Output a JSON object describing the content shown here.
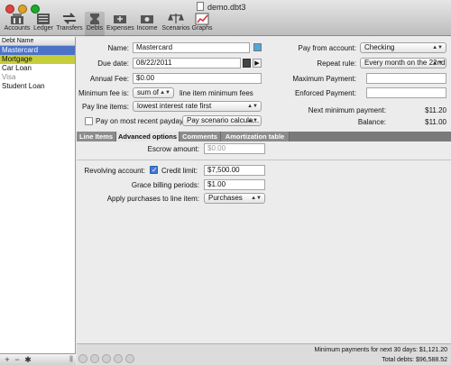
{
  "window": {
    "title": "demo.dbt3"
  },
  "toolbar": {
    "items": [
      {
        "label": "Accounts",
        "icon": "accounts-icon"
      },
      {
        "label": "Ledger",
        "icon": "ledger-icon"
      },
      {
        "label": "Transfers",
        "icon": "transfers-icon"
      },
      {
        "label": "Debts",
        "icon": "debts-icon"
      },
      {
        "label": "Expenses",
        "icon": "expenses-icon"
      },
      {
        "label": "Income",
        "icon": "income-icon"
      },
      {
        "label": "Scenarios",
        "icon": "scenarios-icon"
      },
      {
        "label": "Graphs",
        "icon": "graphs-icon"
      }
    ],
    "selected": "Debts"
  },
  "sidebar": {
    "header": "Debt Name",
    "items": [
      {
        "label": "Mastercard",
        "state": "selected"
      },
      {
        "label": "Mortgage",
        "state": "highlight"
      },
      {
        "label": "Car Loan",
        "state": "normal"
      },
      {
        "label": "Visa",
        "state": "muted"
      },
      {
        "label": "Student Loan",
        "state": "normal"
      }
    ],
    "add_label": "+",
    "remove_label": "−",
    "settings_label": "✱"
  },
  "form": {
    "name_label": "Name:",
    "name_value": "Mastercard",
    "due_date_label": "Due date:",
    "due_date_value": "08/22/2011",
    "annual_fee_label": "Annual Fee:",
    "annual_fee_value": "$0.00",
    "min_fee_label": "Minimum fee is:",
    "min_fee_value": "sum of",
    "min_fee_suffix": "line item minimum fees",
    "pay_line_items_label": "Pay line items:",
    "pay_line_items_value": "lowest interest rate first",
    "pay_recent_label": "Pay on most recent payday",
    "pay_recent_checked": false,
    "pay_scenario_value": "Pay scenario calcula...",
    "pay_from_label": "Pay from account:",
    "pay_from_value": "Checking",
    "repeat_label": "Repeat rule:",
    "repeat_value": "Every month on the 22nd",
    "max_payment_label": "Maximum Payment:",
    "max_payment_value": "",
    "enforced_payment_label": "Enforced Payment:",
    "enforced_payment_value": "",
    "next_min_label": "Next minimum payment:",
    "next_min_value": "$11.20",
    "balance_label": "Balance:",
    "balance_value": "$11.00",
    "color_swatch": "#4fa8d8"
  },
  "tabs": [
    {
      "label": "Line Items",
      "active": false
    },
    {
      "label": "Advanced options",
      "active": true
    },
    {
      "label": "Comments",
      "active": false
    },
    {
      "label": "Amortization table",
      "active": false
    }
  ],
  "advanced": {
    "escrow_label": "Escrow amount:",
    "escrow_placeholder": "$0.00",
    "revolving_label": "Revolving account:",
    "revolving_checked": true,
    "credit_limit_label": "Credit limit:",
    "credit_limit_value": "$7,500.00",
    "grace_label": "Grace billing periods:",
    "grace_value": "$1.00",
    "apply_label": "Apply purchases to line item:",
    "apply_value": "Purchases"
  },
  "status": {
    "min_payments": "Minimum payments for next 30 days: $1,121.20",
    "total_debts": "Total debts: $96,588.52"
  }
}
